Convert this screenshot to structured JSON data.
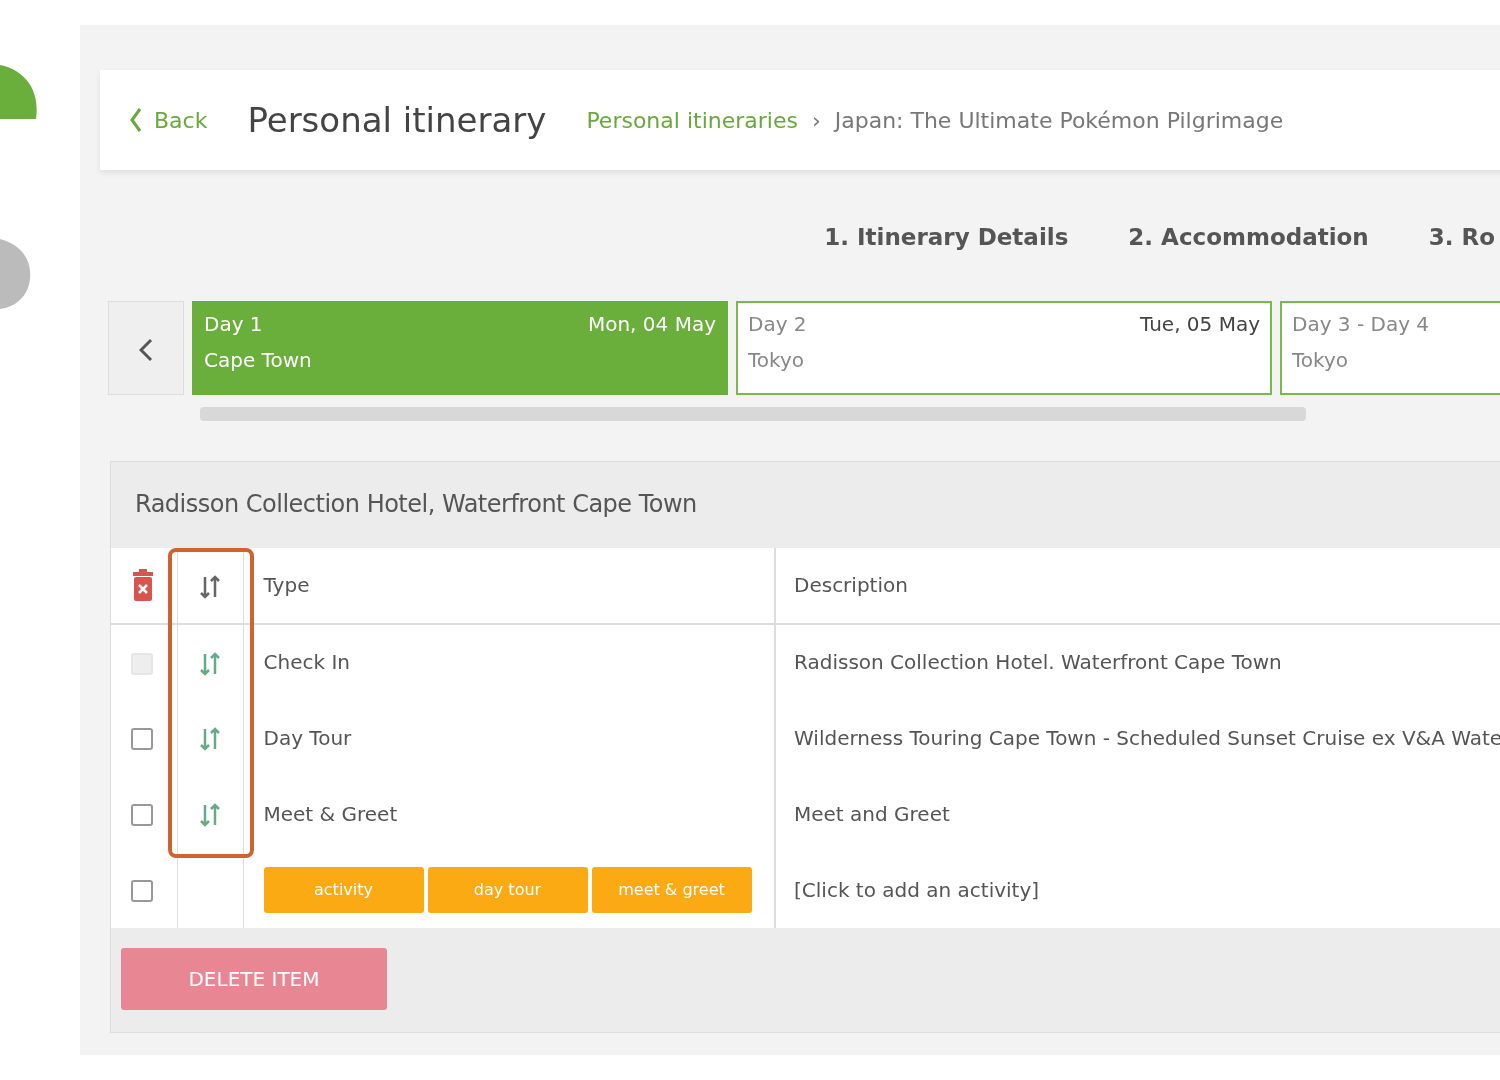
{
  "header": {
    "back": "Back",
    "title": "Personal itinerary",
    "separator": "›",
    "breadcrumbs": [
      {
        "label": "Personal itineraries",
        "link": true
      },
      {
        "label": "Japan: The Ultimate Pokémon Pilgrimage",
        "link": false
      }
    ]
  },
  "steps": [
    {
      "label": "1. Itinerary Details"
    },
    {
      "label": "2. Accommodation"
    },
    {
      "label": "3. Ro"
    }
  ],
  "days": [
    {
      "day": "Day 1",
      "date": "Mon, 04 May",
      "place": "Cape Town",
      "selected": true
    },
    {
      "day": "Day 2",
      "date": "Tue, 05 May",
      "place": "Tokyo",
      "selected": false
    },
    {
      "day": "Day 3 - Day 4",
      "place": "Tokyo",
      "selected": false
    }
  ],
  "panel": {
    "title": "Radisson Collection Hotel, Waterfront Cape Town",
    "table": {
      "columns": [
        "Type",
        "Description"
      ],
      "sort_column_highlighted": true,
      "rows": [
        {
          "checkbox": {
            "checked": false,
            "disabled": true
          },
          "type": "Check In",
          "description": "Radisson Collection Hotel. Waterfront Cape Town"
        },
        {
          "checkbox": {
            "checked": false,
            "disabled": false
          },
          "type": "Day Tour",
          "description": "Wilderness Touring Cape Town - Scheduled Sunset Cruise ex V&A Wate"
        },
        {
          "checkbox": {
            "checked": false,
            "disabled": false
          },
          "type": "Meet & Greet",
          "description": "Meet and Greet"
        }
      ],
      "add_row": {
        "checkbox": {
          "checked": false,
          "disabled": false
        },
        "buttons": [
          "activity",
          "day tour",
          "meet & greet"
        ],
        "description": "[Click to add an activity]"
      }
    },
    "delete_button": "DELETE ITEM"
  }
}
